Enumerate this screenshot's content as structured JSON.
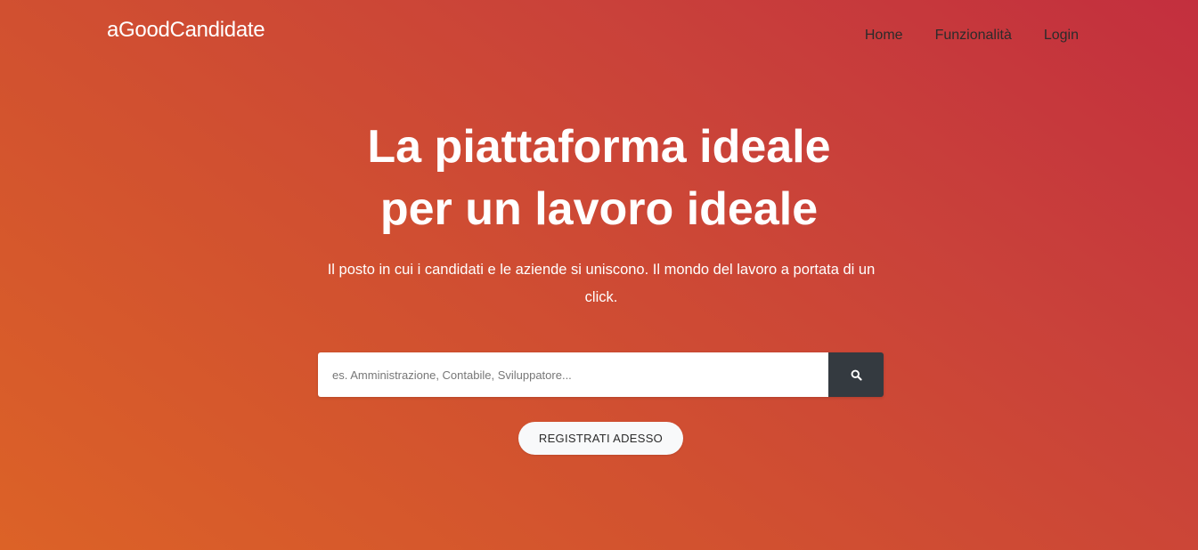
{
  "brand": {
    "name": "aGoodCandidate"
  },
  "nav": {
    "items": [
      {
        "label": "Home"
      },
      {
        "label": "Funzionalità"
      },
      {
        "label": "Login"
      }
    ]
  },
  "hero": {
    "title_line1": "La piattaforma ideale",
    "title_line2": "per un lavoro ideale",
    "subtitle": "Il posto in cui i candidati e le aziende si uniscono. Il mondo del lavoro a portata di un click."
  },
  "search": {
    "placeholder": "es. Amministrazione, Contabile, Sviluppatore...",
    "value": "",
    "icon": "search-icon"
  },
  "cta": {
    "label": "REGISTRATI ADESSO"
  },
  "colors": {
    "gradient_start": "#dc6227",
    "gradient_end": "#c32f3e",
    "search_button": "#343a40",
    "cta_background": "#f8f9fa"
  }
}
